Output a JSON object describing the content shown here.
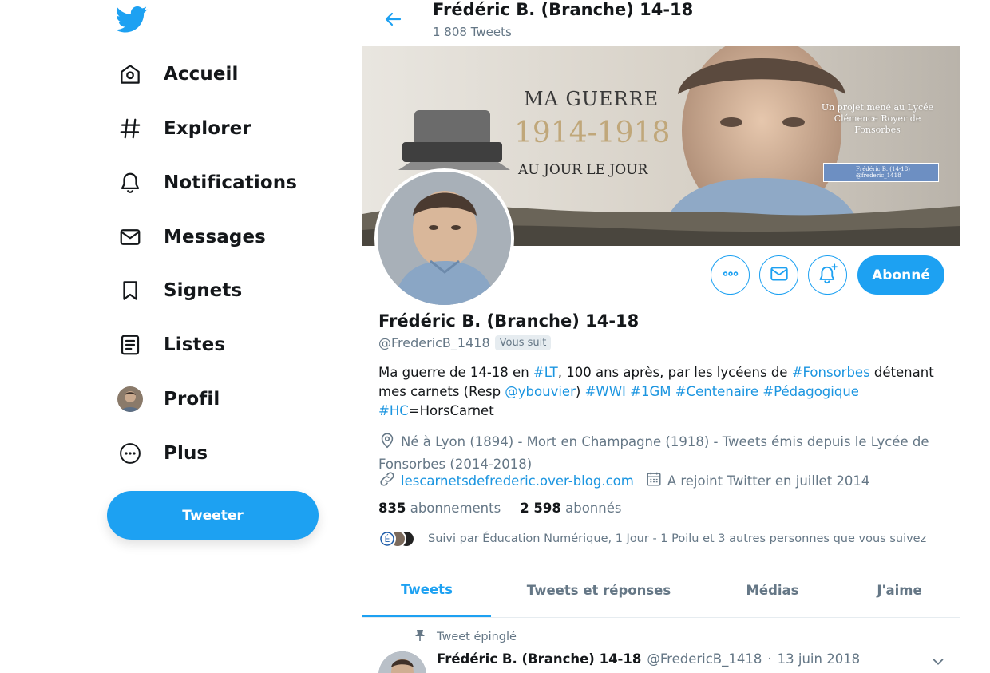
{
  "sidebar": {
    "logo": "twitter-bird-icon",
    "items": [
      {
        "label": "Accueil",
        "icon": "home-icon"
      },
      {
        "label": "Explorer",
        "icon": "hashtag-icon"
      },
      {
        "label": "Notifications",
        "icon": "bell-icon"
      },
      {
        "label": "Messages",
        "icon": "envelope-icon"
      },
      {
        "label": "Signets",
        "icon": "bookmark-icon"
      },
      {
        "label": "Listes",
        "icon": "list-icon"
      },
      {
        "label": "Profil",
        "icon": "avatar"
      },
      {
        "label": "Plus",
        "icon": "more-circle-icon"
      }
    ],
    "tweet_button": "Tweeter"
  },
  "header": {
    "title": "Frédéric B. (Branche) 14-18",
    "tweet_count": "1 808 Tweets"
  },
  "banner": {
    "line1": "MA GUERRE",
    "years": "1914-1918",
    "line2": "AU JOUR LE JOUR",
    "project_line1": "Un projet mené au Lycée",
    "project_line2": "Clémence Royer de Fonsorbes",
    "badge_name": "Frédéric B. (14-18)",
    "badge_handle": "@frederic_1418"
  },
  "profile": {
    "name": "Frédéric B. (Branche) 14-18",
    "handle": "@FredericB_1418",
    "follows_you": "Vous suit",
    "follow_button": "Abonné",
    "bio": {
      "t1": "Ma guerre de 14-18 en ",
      "h_lt": "#LT",
      "t2": ", 100 ans après, par les lycéens de ",
      "h_fonsorbes": "#Fonsorbes",
      "t3": " détenant mes carnets (Resp ",
      "m_ybouvier": "@ybouvier",
      "t4": ") ",
      "h_wwi": "#WWI",
      "h_1gm": "#1GM",
      "h_centenaire": "#Centenaire",
      "h_pedagogique": "#Pédagogique",
      "h_hc": "#HC",
      "t5": "=HorsCarnet"
    },
    "location": "Né à Lyon (1894) - Mort en Champagne (1918) - Tweets émis depuis le Lycée de Fonsorbes (2014-2018)",
    "website": "lescarnetsdefrederic.over-blog.com",
    "joined": "A rejoint Twitter en juillet 2014",
    "following_count": "835",
    "following_label": "abonnements",
    "followers_count": "2 598",
    "followers_label": "abonnés",
    "followed_by": "Suivi par Éducation Numérique, 1 Jour - 1 Poilu et 3 autres personnes que vous suivez"
  },
  "tabs": [
    {
      "label": "Tweets",
      "active": true
    },
    {
      "label": "Tweets et réponses",
      "active": false
    },
    {
      "label": "Médias",
      "active": false
    },
    {
      "label": "J'aime",
      "active": false
    }
  ],
  "pinned_tweet": {
    "pinned_label": "Tweet épinglé",
    "author": "Frédéric B. (Branche) 14-18",
    "handle": "@FredericB_1418",
    "separator": "·",
    "date": "13 juin 2018"
  },
  "colors": {
    "accent": "#1da1f2",
    "link": "#1b95e0",
    "muted": "#657786",
    "text": "#14171a",
    "border": "#e6ecf0"
  }
}
